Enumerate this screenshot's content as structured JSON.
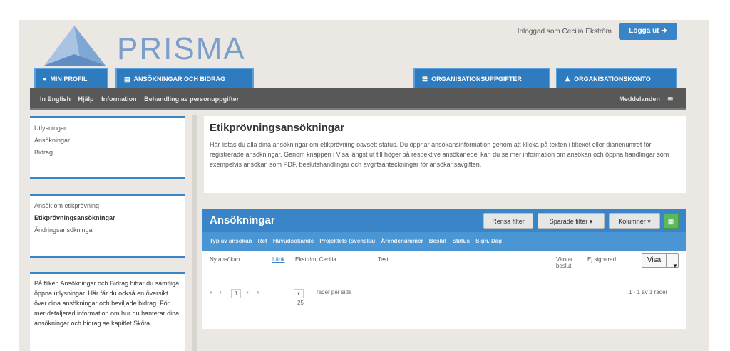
{
  "header": {
    "brand": "PRISMA",
    "logged_in_as": "Inloggad som Cecilia Ekström",
    "logout_label": "Logga ut"
  },
  "tabs": [
    {
      "label": "MIN PROFIL",
      "icon": "user-icon"
    },
    {
      "label": "ANSÖKNINGAR OCH BIDRAG",
      "icon": "document-icon"
    },
    {
      "label": "ORGANISATIONSUPPGIFTER",
      "icon": "list-icon"
    },
    {
      "label": "ORGANISATIONSKONTO",
      "icon": "users-icon"
    }
  ],
  "subnav": {
    "items": [
      "In English",
      "Hjälp",
      "Information",
      "Behandling av personuppgifter"
    ],
    "messages_label": "Meddelanden"
  },
  "sidebar": {
    "group1": [
      "Utlysningar",
      "Ansökningar",
      "Bidrag"
    ],
    "group2": [
      "Ansök om etikprövning",
      "Etikprövningsansökningar",
      "Ändringsansökningar"
    ],
    "help_text": "På fliken Ansökningar och Bidrag hittar du samtliga öppna utlysningar. Här får du också en översikt över dina ansökningar och beviljade bidrag. För mer detaljerad information om hur du hanterar dina ansökningar och bidrag se kapitlet Sköta"
  },
  "intro": {
    "title": "Etikprövningsansökningar",
    "text": "Här listas du alla dina ansökningar om etikprövning oavsett status. Du öppnar ansökansinformation genom att klicka på texten i tiltexet eller diarienumret för registrerade ansökningar. Genom knappen i Visa längst ut till höger på respektive ansökanedel kan du se mer information om ansökan och öppna handlingar som exempelvis ansökan som PDF, beslutshandlingar och avgiftsanteckningar för ansökansavgiften."
  },
  "applications": {
    "title": "Ansökningar",
    "buttons": {
      "reset": "Rensa filter",
      "saved": "Sparade filter",
      "columns": "Kolumner"
    },
    "columns": [
      "Typ av ansökan",
      "Ref",
      "Huvudsökande",
      "Projektets (svenska)",
      "Ärendenummer",
      "Beslut",
      "Status",
      "Sign. Dag"
    ],
    "row": {
      "type": "Ny ansökan",
      "ref": "Länk",
      "applicant": "Ekström, Cecilia",
      "project": "Test",
      "status_l1": "Väntar",
      "status_l2": "beslut",
      "registered": "Ej signerad",
      "action": "Visa"
    },
    "pager": {
      "page": "1",
      "per_page": "25",
      "per_page_label": "rader per sida",
      "summary": "1 - 1 av 1 rader"
    }
  },
  "colors": {
    "primary": "#3a85c8",
    "nav": "#585858",
    "background": "#ebe7e3"
  }
}
